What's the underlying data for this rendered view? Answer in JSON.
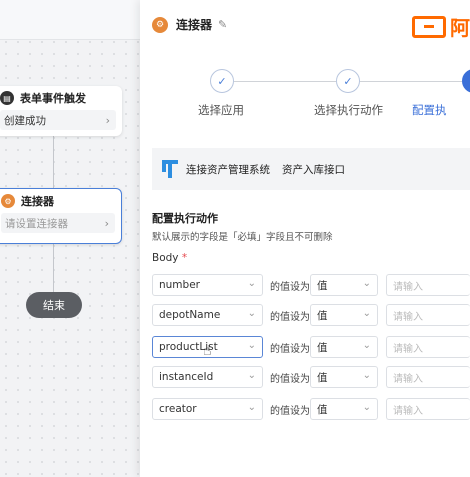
{
  "canvas": {
    "node1": {
      "title": "表单事件触发",
      "body": "创建成功"
    },
    "node2": {
      "title": "连接器",
      "body": "请设置连接器"
    },
    "end": "结束"
  },
  "panel": {
    "title": "连接器",
    "logo_text": "阿"
  },
  "steps": [
    {
      "label": "选择应用",
      "state": "done"
    },
    {
      "label": "选择执行动作",
      "state": "done"
    },
    {
      "label": "配置执",
      "state": "active"
    }
  ],
  "connector": {
    "system": "连接资产管理系统",
    "api": "资产入库接口"
  },
  "section": {
    "title": "配置执行动作",
    "desc": "默认展示的字段是「必填」字段且不可删除",
    "body_label": "Body",
    "required_mark": "*"
  },
  "rows": [
    {
      "field": "number",
      "suffix": "的值设为",
      "value_type": "值",
      "placeholder": "请输入"
    },
    {
      "field": "depotName",
      "suffix": "的值设为",
      "value_type": "值",
      "placeholder": "请输入"
    },
    {
      "field": "productList",
      "suffix": "的值设为",
      "value_type": "值",
      "placeholder": "请输入"
    },
    {
      "field": "instanceId",
      "suffix": "的值设为",
      "value_type": "值",
      "placeholder": "请输入"
    },
    {
      "field": "creator",
      "suffix": "的值设为",
      "value_type": "值",
      "placeholder": "请输入"
    }
  ],
  "colors": {
    "accent": "#3a6fd8",
    "brand": "#ff6a00",
    "node_icon": "#e6893a"
  }
}
